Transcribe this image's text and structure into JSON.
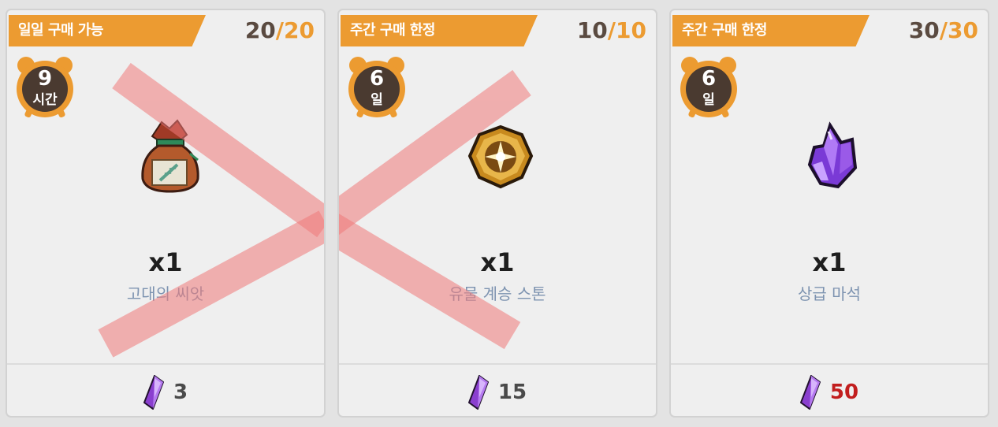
{
  "products": [
    {
      "limit_label": "일일 구매 가능",
      "count": "20",
      "sep": "/",
      "max": "20",
      "timer_value": "9",
      "timer_unit": "시간",
      "item_icon": "seed-bag-icon",
      "quantity": "x1",
      "name": "고대의 씨앗",
      "price": "3",
      "price_color": "#4a4a4a",
      "sold_out": true
    },
    {
      "limit_label": "주간 구매 한정",
      "count": "10",
      "sep": "/",
      "max": "10",
      "timer_value": "6",
      "timer_unit": "일",
      "item_icon": "relic-stone-icon",
      "quantity": "x1",
      "name": "유물 계승 스톤",
      "price": "15",
      "price_color": "#4a4a4a",
      "sold_out": true
    },
    {
      "limit_label": "주간 구매 한정",
      "count": "30",
      "sep": "/",
      "max": "30",
      "timer_value": "6",
      "timer_unit": "일",
      "item_icon": "purple-crystal-icon",
      "quantity": "x1",
      "name": "상급 마석",
      "price": "50",
      "price_color": "#c21e1e",
      "sold_out": false
    }
  ],
  "currency_icon": "purple-gem-icon",
  "colors": {
    "accent": "#ec9b31",
    "card_bg": "#efefef",
    "name_text": "#7d93b0",
    "soldout_x": "#f07a7a"
  }
}
